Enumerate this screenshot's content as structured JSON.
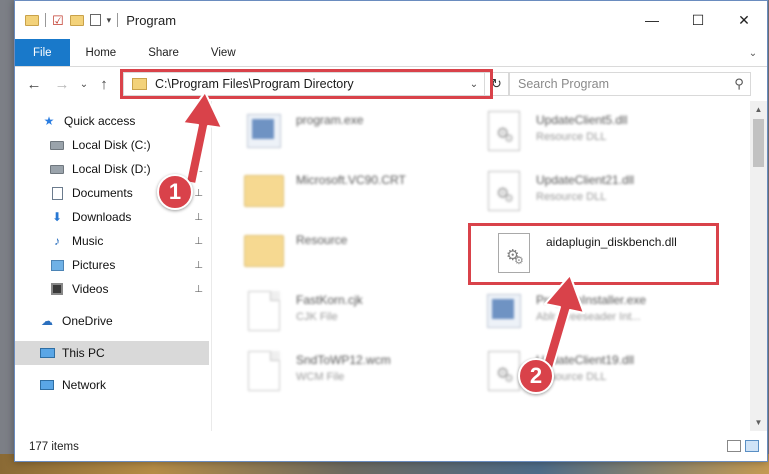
{
  "window": {
    "title": "Program",
    "controls": {
      "minimize": "—",
      "maximize": "☐",
      "close": "✕"
    }
  },
  "ribbon": {
    "tabs": [
      "File",
      "Home",
      "Share",
      "View"
    ],
    "expand_glyph": "⌄"
  },
  "nav": {
    "back": "←",
    "forward": "→",
    "recent": "⌄",
    "up": "↑"
  },
  "address": {
    "path": "C:\\Program Files\\Program Directory",
    "dropdown": "⌄",
    "refresh": "↻"
  },
  "search": {
    "placeholder": "Search Program",
    "icon": "⚲"
  },
  "sidebar": {
    "items": [
      {
        "label": "Quick access",
        "icon": "star-icon",
        "pinned": false
      },
      {
        "label": "Local Disk (C:)",
        "icon": "drive-icon",
        "pinned": true
      },
      {
        "label": "Local Disk (D:)",
        "icon": "drive-icon",
        "pinned": true
      },
      {
        "label": "Documents",
        "icon": "documents-icon",
        "pinned": true
      },
      {
        "label": "Downloads",
        "icon": "download-icon",
        "pinned": true
      },
      {
        "label": "Music",
        "icon": "music-icon",
        "pinned": true
      },
      {
        "label": "Pictures",
        "icon": "pictures-icon",
        "pinned": true
      },
      {
        "label": "Videos",
        "icon": "videos-icon",
        "pinned": true
      },
      {
        "label": "OneDrive",
        "icon": "cloud-icon",
        "pinned": false
      },
      {
        "label": "This PC",
        "icon": "computer-icon",
        "pinned": false,
        "selected": true
      },
      {
        "label": "Network",
        "icon": "network-icon",
        "pinned": false
      }
    ],
    "pin_glyph": "📌"
  },
  "files": [
    {
      "name": "program.exe",
      "type": "",
      "icon": "exe-icon",
      "blurred": true
    },
    {
      "name": "UpdateClient5.dll",
      "type": "Resource DLL",
      "icon": "dll-icon",
      "blurred": true
    },
    {
      "name": "Microsoft.VC90.CRT",
      "type": "",
      "icon": "folder-icon",
      "blurred": true
    },
    {
      "name": "UpdateClient21.dll",
      "type": "Resource DLL",
      "icon": "dll-icon",
      "blurred": true
    },
    {
      "name": "Resource",
      "type": "",
      "icon": "folder-icon",
      "blurred": true
    },
    {
      "name": "aidaplugin_diskbench.dll",
      "type": "",
      "icon": "dll-icon",
      "blurred": false
    },
    {
      "name": "FastKorn.cjk",
      "type": "CJK File",
      "icon": "file-icon",
      "blurred": true
    },
    {
      "name": "ProgramInstaller.exe",
      "type": "Ablr Rreeseader Int...",
      "icon": "exe-icon",
      "blurred": true
    },
    {
      "name": "SndToWP12.wcm",
      "type": "WCM File",
      "icon": "file-icon",
      "blurred": true
    },
    {
      "name": "UpdateClient19.dll",
      "type": "Resource DLL",
      "icon": "dll-icon",
      "blurred": true
    }
  ],
  "status": {
    "count": "177 items"
  },
  "annotations": {
    "badge1": "1",
    "badge2": "2",
    "color": "#d9424a"
  },
  "colors": {
    "file_tab": "#1979ca",
    "selected_nav": "#d9d9d9",
    "highlight": "#d9424a"
  }
}
